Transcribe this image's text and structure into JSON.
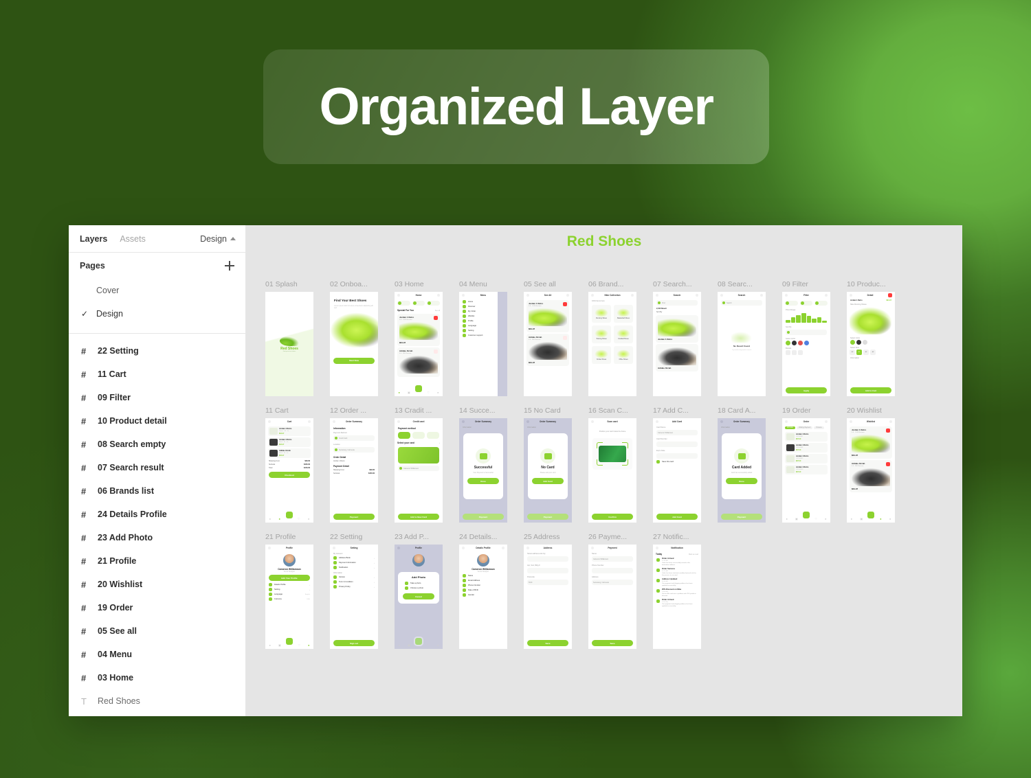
{
  "hero": {
    "title": "Organized Layer"
  },
  "sidebar": {
    "tabs": [
      {
        "label": "Layers",
        "active": true
      },
      {
        "label": "Assets",
        "active": false
      }
    ],
    "design_label": "Design",
    "pages_label": "Pages",
    "add_page_icon": "plus-icon",
    "pages": [
      {
        "label": "Cover",
        "selected": false
      },
      {
        "label": "Design",
        "selected": true
      }
    ],
    "layers": [
      {
        "icon": "frame-icon",
        "label": "22 Setting"
      },
      {
        "icon": "frame-icon",
        "label": "11 Cart"
      },
      {
        "icon": "frame-icon",
        "label": "09 Filter"
      },
      {
        "icon": "frame-icon",
        "label": "10 Product detail"
      },
      {
        "icon": "frame-icon",
        "label": "08 Search empty"
      },
      {
        "icon": "frame-icon",
        "label": "07 Search result"
      },
      {
        "icon": "frame-icon",
        "label": "06 Brands list"
      },
      {
        "icon": "frame-icon",
        "label": "24 Details Profile"
      },
      {
        "icon": "frame-icon",
        "label": "23 Add Photo"
      },
      {
        "icon": "frame-icon",
        "label": "21 Profile"
      },
      {
        "icon": "frame-icon",
        "label": "20 Wishlist"
      },
      {
        "icon": "frame-icon",
        "label": "19 Order"
      },
      {
        "icon": "frame-icon",
        "label": "05 See all"
      },
      {
        "icon": "frame-icon",
        "label": "04 Menu"
      },
      {
        "icon": "frame-icon",
        "label": "03 Home"
      },
      {
        "icon": "text-icon",
        "label": "Red Shoes"
      }
    ]
  },
  "canvas": {
    "title": "Red Shoes",
    "accent": "#8cd22f",
    "background": "#e5e5e5",
    "rows": [
      [
        {
          "label": "01 Splash"
        },
        {
          "label": "02 Onboa..."
        },
        {
          "label": "03 Home"
        },
        {
          "label": "04 Menu"
        },
        {
          "label": "05 See all"
        },
        {
          "label": "06 Brand..."
        },
        {
          "label": "07 Search..."
        },
        {
          "label": "08 Searc..."
        },
        {
          "label": "09 Filter"
        },
        {
          "label": "10 Produc..."
        }
      ],
      [
        {
          "label": "11 Cart"
        },
        {
          "label": "12 Order ..."
        },
        {
          "label": "13 Cradit ..."
        },
        {
          "label": "14 Succe..."
        },
        {
          "label": "15 No Card"
        },
        {
          "label": "16 Scan C..."
        },
        {
          "label": "17 Add C..."
        },
        {
          "label": "18 Card A..."
        },
        {
          "label": "19 Order"
        },
        {
          "label": "20 Wishlist"
        }
      ],
      [
        {
          "label": "21 Profile"
        },
        {
          "label": "22 Setting"
        },
        {
          "label": "23 Add P..."
        },
        {
          "label": "24 Details..."
        },
        {
          "label": "25 Address"
        },
        {
          "label": "26 Payme..."
        },
        {
          "label": "27 Notific..."
        }
      ]
    ]
  },
  "screens": {
    "splash": {
      "brand": "Red Shoes",
      "tagline": "Find your best shoes"
    },
    "onboarding": {
      "title": "Find Your Best Shoes",
      "subtitle": "Lorem ipsum dolor sit amet consectetur adipiscing elit sed",
      "cta": "Start Now"
    },
    "home": {
      "title": "Home",
      "chips": [
        "Nike",
        "Puma",
        "Adidas"
      ],
      "section": "Special For You",
      "see_all": "See all",
      "products": [
        {
          "name": "Jordan 1 Retro",
          "rating": "4.8 · 1245 Reviews",
          "price": "$64.97"
        },
        {
          "name": "Adidas Ozrah",
          "rating": "4.6 · 980 Reviews",
          "price": "$56.97"
        }
      ]
    },
    "menu": {
      "title": "Menu",
      "items": [
        "Home",
        "Discover",
        "My Order",
        "Wishlist",
        "Profile",
        "Language",
        "Setting",
        "Customer support"
      ]
    },
    "see_all": {
      "title": "See All",
      "products": [
        {
          "name": "Jordan 1 Retro",
          "rating": "4.8 · 1245 Reviews",
          "price": "$64.97"
        },
        {
          "name": "Adidas Ozrah",
          "rating": "4.6 · 980 Reviews",
          "price": "$64.97"
        }
      ]
    },
    "brands": {
      "title": "Nike Collection",
      "count": "1001 Items here",
      "cells": [
        "Running Shoes",
        "Basketball Shoes",
        "Training Shoes",
        "Football Shoes",
        "Cricket Shoes",
        "Office Shoes"
      ]
    },
    "search_result": {
      "title": "Search",
      "placeholder": "Find",
      "count": "2,310 Result",
      "sort": "Sort By",
      "products": [
        "Jordan 1 Retro",
        "Adidas Ozrah"
      ]
    },
    "search_empty": {
      "title": "Search",
      "placeholder": "Search",
      "empty_title": "No Result Found",
      "empty_sub": "Try another keyword to search"
    },
    "filter": {
      "title": "Filter",
      "price_label": "Price Range",
      "sort_label": "Sort By",
      "color_label": "Select Color",
      "brand_label": "Brands",
      "apply": "Apply"
    },
    "product_detail": {
      "title": "Detail",
      "name": "Jordan 1 Retro",
      "sub": "Nike Running Shoes",
      "price": "$64.97",
      "color_label": "Select Color",
      "size_label": "Select Size",
      "info_label": "Information",
      "cta": "Add to Cart"
    },
    "cart": {
      "title": "Cart",
      "items": [
        {
          "name": "Jordan 1 Retro",
          "meta": "Green · 42 · 1x",
          "price": "$64.97"
        },
        {
          "name": "Jordan 1 Retro",
          "meta": "Black · 41 · 1x",
          "price": "$64.97"
        },
        {
          "name": "Adidas Ozrah",
          "meta": "Black · 43 · 1x",
          "price": "$56.97"
        }
      ],
      "lines": [
        {
          "label": "Shipping Cost",
          "value": "$49.00"
        },
        {
          "label": "Subtotal",
          "value": "$150.00"
        },
        {
          "label": "Total",
          "value": "$179.00"
        }
      ],
      "cta": "Checkout"
    },
    "order_summary": {
      "title": "Order Summary",
      "information": "Information",
      "payment_method_label": "Payment Method",
      "payment_method_value": "Credit Card",
      "location_label": "Location",
      "location_value": "Semarang, Indonesia",
      "order_detail": "Order Detail",
      "order_item": "Jordan 1 Retro",
      "order_item_meta": "Green · 42 · 1x",
      "payment_detail": "Payment Detail",
      "lines": [
        {
          "label": "Shipping Cost",
          "value": "$49.00"
        },
        {
          "label": "Subtotal",
          "value": "$150.00"
        }
      ],
      "cta": "Payment"
    },
    "credit_card": {
      "title": "Credit card",
      "method_label": "Payment method",
      "select_label": "Select your card",
      "balance_label": "Your balance",
      "balance": "$12,800",
      "holder": "Cameron Williamson",
      "cta": "Add to New Card"
    },
    "successful": {
      "title": "Order Summary",
      "heading": "Successful",
      "sub": "Your Payment is Successful",
      "cta": "Done"
    },
    "no_card": {
      "title": "Order Summary",
      "heading": "No Card",
      "sub": "Please add your card",
      "cta": "Add Card"
    },
    "scan_card": {
      "title": "Scan card",
      "hint": "Position your card inside the frame",
      "cta": "Confirm"
    },
    "add_card": {
      "title": "Add Card",
      "name_label": "Card Name",
      "name_value": "Cameron Williamson",
      "number_label": "Card Number",
      "expiry_label": "Exp's Date",
      "cvv_label": "CVV",
      "save_label": "Save this card",
      "cta": "Add Card"
    },
    "card_added": {
      "title": "Order Summary",
      "heading": "Card Added",
      "sub": "Card has successfully added",
      "cta": "Done"
    },
    "order": {
      "title": "Order",
      "tabs": [
        "All Order",
        "Waiting Payment",
        "Process"
      ],
      "items": [
        {
          "name": "Jordan 1 Retro",
          "meta": "#11254987",
          "price": "$67.00",
          "status": "Paid"
        },
        {
          "name": "Jordan 1 Retro",
          "meta": "#11254988",
          "price": "$67.00",
          "status": "Delivery"
        },
        {
          "name": "Jordan 1 Retro",
          "meta": "#11254989",
          "price": "$67.00",
          "status": "Process"
        },
        {
          "name": "Jordan 1 Retro",
          "meta": "#11254990",
          "price": "$67.00",
          "status": "Arrived"
        }
      ]
    },
    "wishlist": {
      "title": "Wishlist",
      "products": [
        {
          "name": "Jordan 1 Retro",
          "rating": "4.8 · 1245 Reviews",
          "price": "$64.97"
        },
        {
          "name": "Adidas Ozrah",
          "rating": "4.6 · 980 Reviews",
          "price": "$64.97"
        }
      ]
    },
    "profile": {
      "title": "Profile",
      "name": "Cameron Williamson",
      "role": "Senior Designer",
      "cta": "Edit Your Profile",
      "items": [
        {
          "label": "Details Profile",
          "value": ""
        },
        {
          "label": "Setting",
          "value": ""
        },
        {
          "label": "Language",
          "value": "English"
        },
        {
          "label": "Currency",
          "value": "USD"
        }
      ]
    },
    "setting": {
      "title": "Setting",
      "group1": "My Account",
      "items1": [
        "Address Book",
        "Payment Information",
        "Notification"
      ],
      "group2": "Information",
      "items2": [
        "Version",
        "Term & Condition",
        "Privacy Policy"
      ],
      "cta": "Sign out"
    },
    "add_photo": {
      "title": "Profile",
      "sheet_title": "Add Photo",
      "options": [
        "Take a photo",
        "Choose a photo"
      ],
      "cancel": "Cancel"
    },
    "details_profile": {
      "title": "Details Profile",
      "items": [
        "Name",
        "Email Address",
        "Phone Number",
        "Date of Birth",
        "Gender"
      ],
      "cta": "Save"
    },
    "address": {
      "title": "Address",
      "street_label": "Street address and city",
      "apt_label": "Apt, Suit, Bldg #",
      "postcode_label": "Postcode",
      "postcode_value": "5019",
      "cta": "Save"
    },
    "payment": {
      "title": "Payment",
      "name_label": "Name",
      "name_value": "Cameron Williamson",
      "phone_label": "Phone Number",
      "address_label": "Address",
      "address_value": "Semarang, Indonesia",
      "cta": "Save"
    },
    "notification": {
      "title": "Notification",
      "today": "Today",
      "mark_all": "Mark as read",
      "items": [
        {
          "title": "Order Arrived",
          "time": "12:30 AM",
          "body": "Order has been successfully arrived at the destination address"
        },
        {
          "title": "Order Success",
          "time": "09:15 AM",
          "body": "Order has been checked carefully & placed safe for the process to succeed"
        },
        {
          "title": "Address Updated",
          "time": "08:00 AM",
          "body": "Your payment and shipping address has been updated successfully"
        },
        {
          "title": "25% Discount on Nike",
          "time": "Yesterday",
          "body": "Get an offer and earn a problem with 25% products discount"
        },
        {
          "title": "Order Arrived",
          "time": "Yesterday",
          "body": "Your payment and shipping address has been updated successfully"
        }
      ]
    }
  }
}
